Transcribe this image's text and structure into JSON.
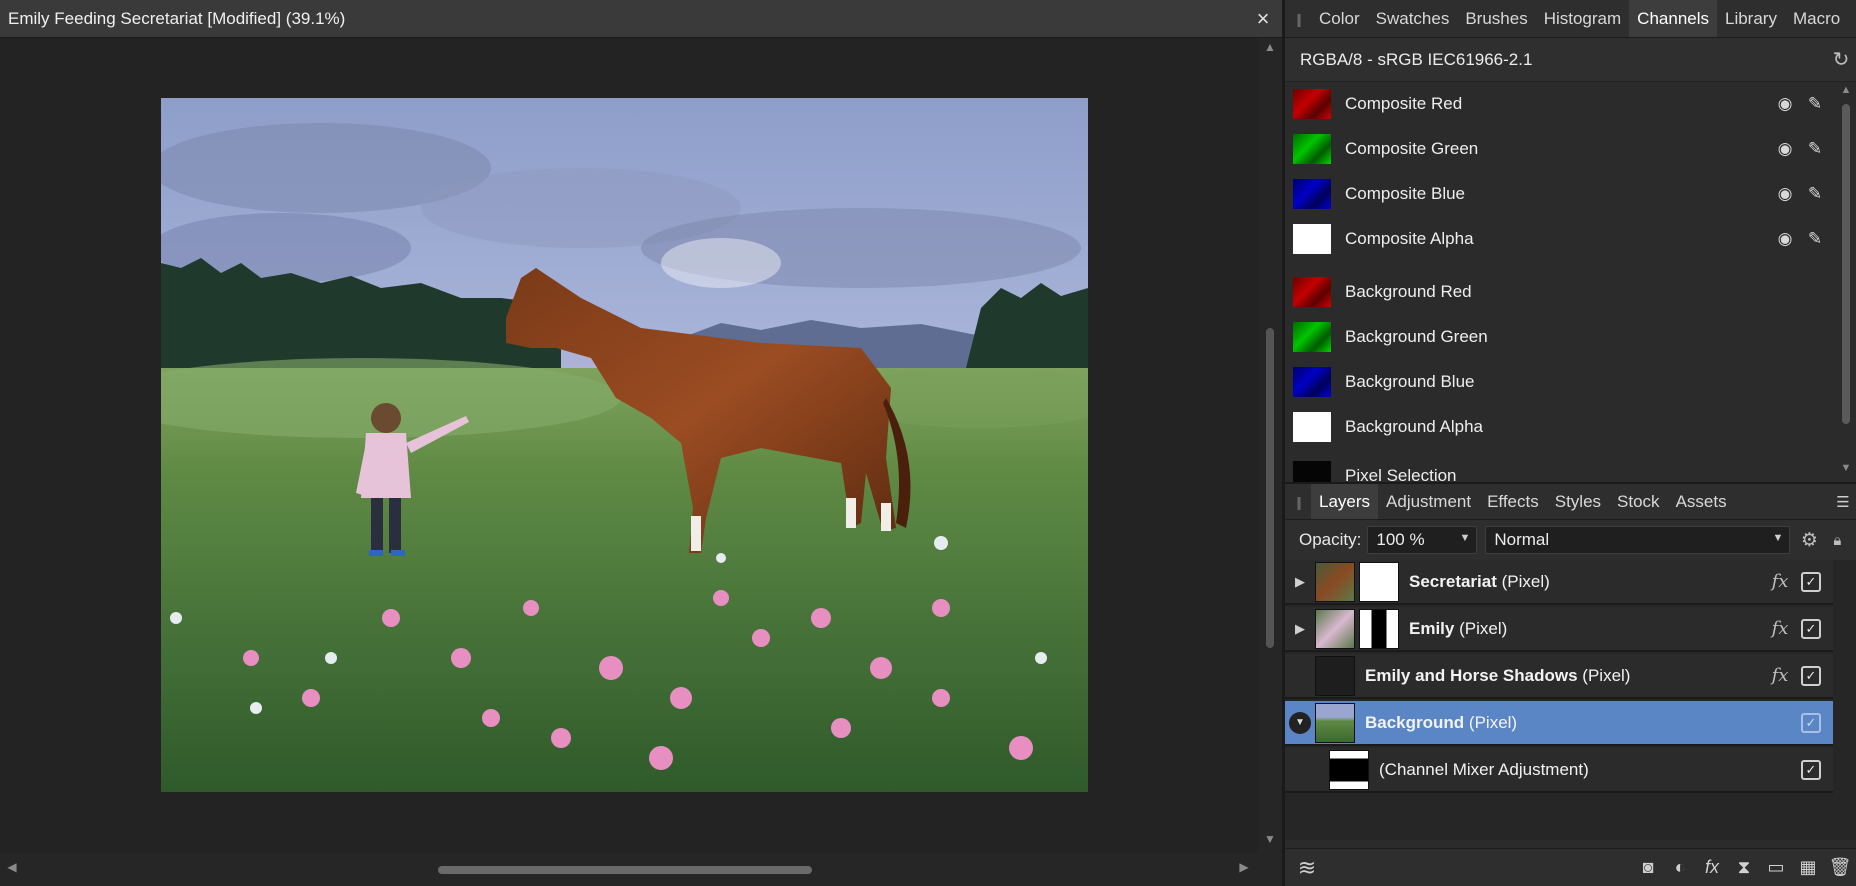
{
  "document": {
    "title": "Emily Feeding Secretariat [Modified] (39.1%)",
    "close_icon": "×"
  },
  "top_panel": {
    "tabs": [
      "Color",
      "Swatches",
      "Brushes",
      "Histogram",
      "Channels",
      "Library",
      "Macro"
    ],
    "active_tab": "Channels"
  },
  "channels": {
    "color_profile": "RGBA/8 - sRGB IEC61966-2.1",
    "composite": [
      {
        "label": "Composite Red",
        "swatch": "red"
      },
      {
        "label": "Composite Green",
        "swatch": "green"
      },
      {
        "label": "Composite Blue",
        "swatch": "blue"
      },
      {
        "label": "Composite Alpha",
        "swatch": "white"
      }
    ],
    "background": [
      {
        "label": "Background Red",
        "swatch": "red"
      },
      {
        "label": "Background Green",
        "swatch": "green"
      },
      {
        "label": "Background Blue",
        "swatch": "blue"
      },
      {
        "label": "Background Alpha",
        "swatch": "white"
      }
    ],
    "partial_row_label": "Pixel Selection"
  },
  "layers_panel": {
    "tabs": [
      "Layers",
      "Adjustment",
      "Effects",
      "Styles",
      "Stock",
      "Assets"
    ],
    "active_tab": "Layers",
    "opacity_label": "Opacity:",
    "opacity_value": "100 %",
    "blend_mode": "Normal",
    "layers": [
      {
        "name": "Secretariat",
        "type": "(Pixel)"
      },
      {
        "name": "Emily",
        "type": "(Pixel)"
      },
      {
        "name": "Emily and Horse Shadows",
        "type": "(Pixel)"
      },
      {
        "name": "Background",
        "type": "(Pixel)"
      },
      {
        "name": "",
        "type": "(Channel Mixer Adjustment)"
      }
    ],
    "selected_layer": "Background",
    "accent_color": "#5b86c6"
  }
}
